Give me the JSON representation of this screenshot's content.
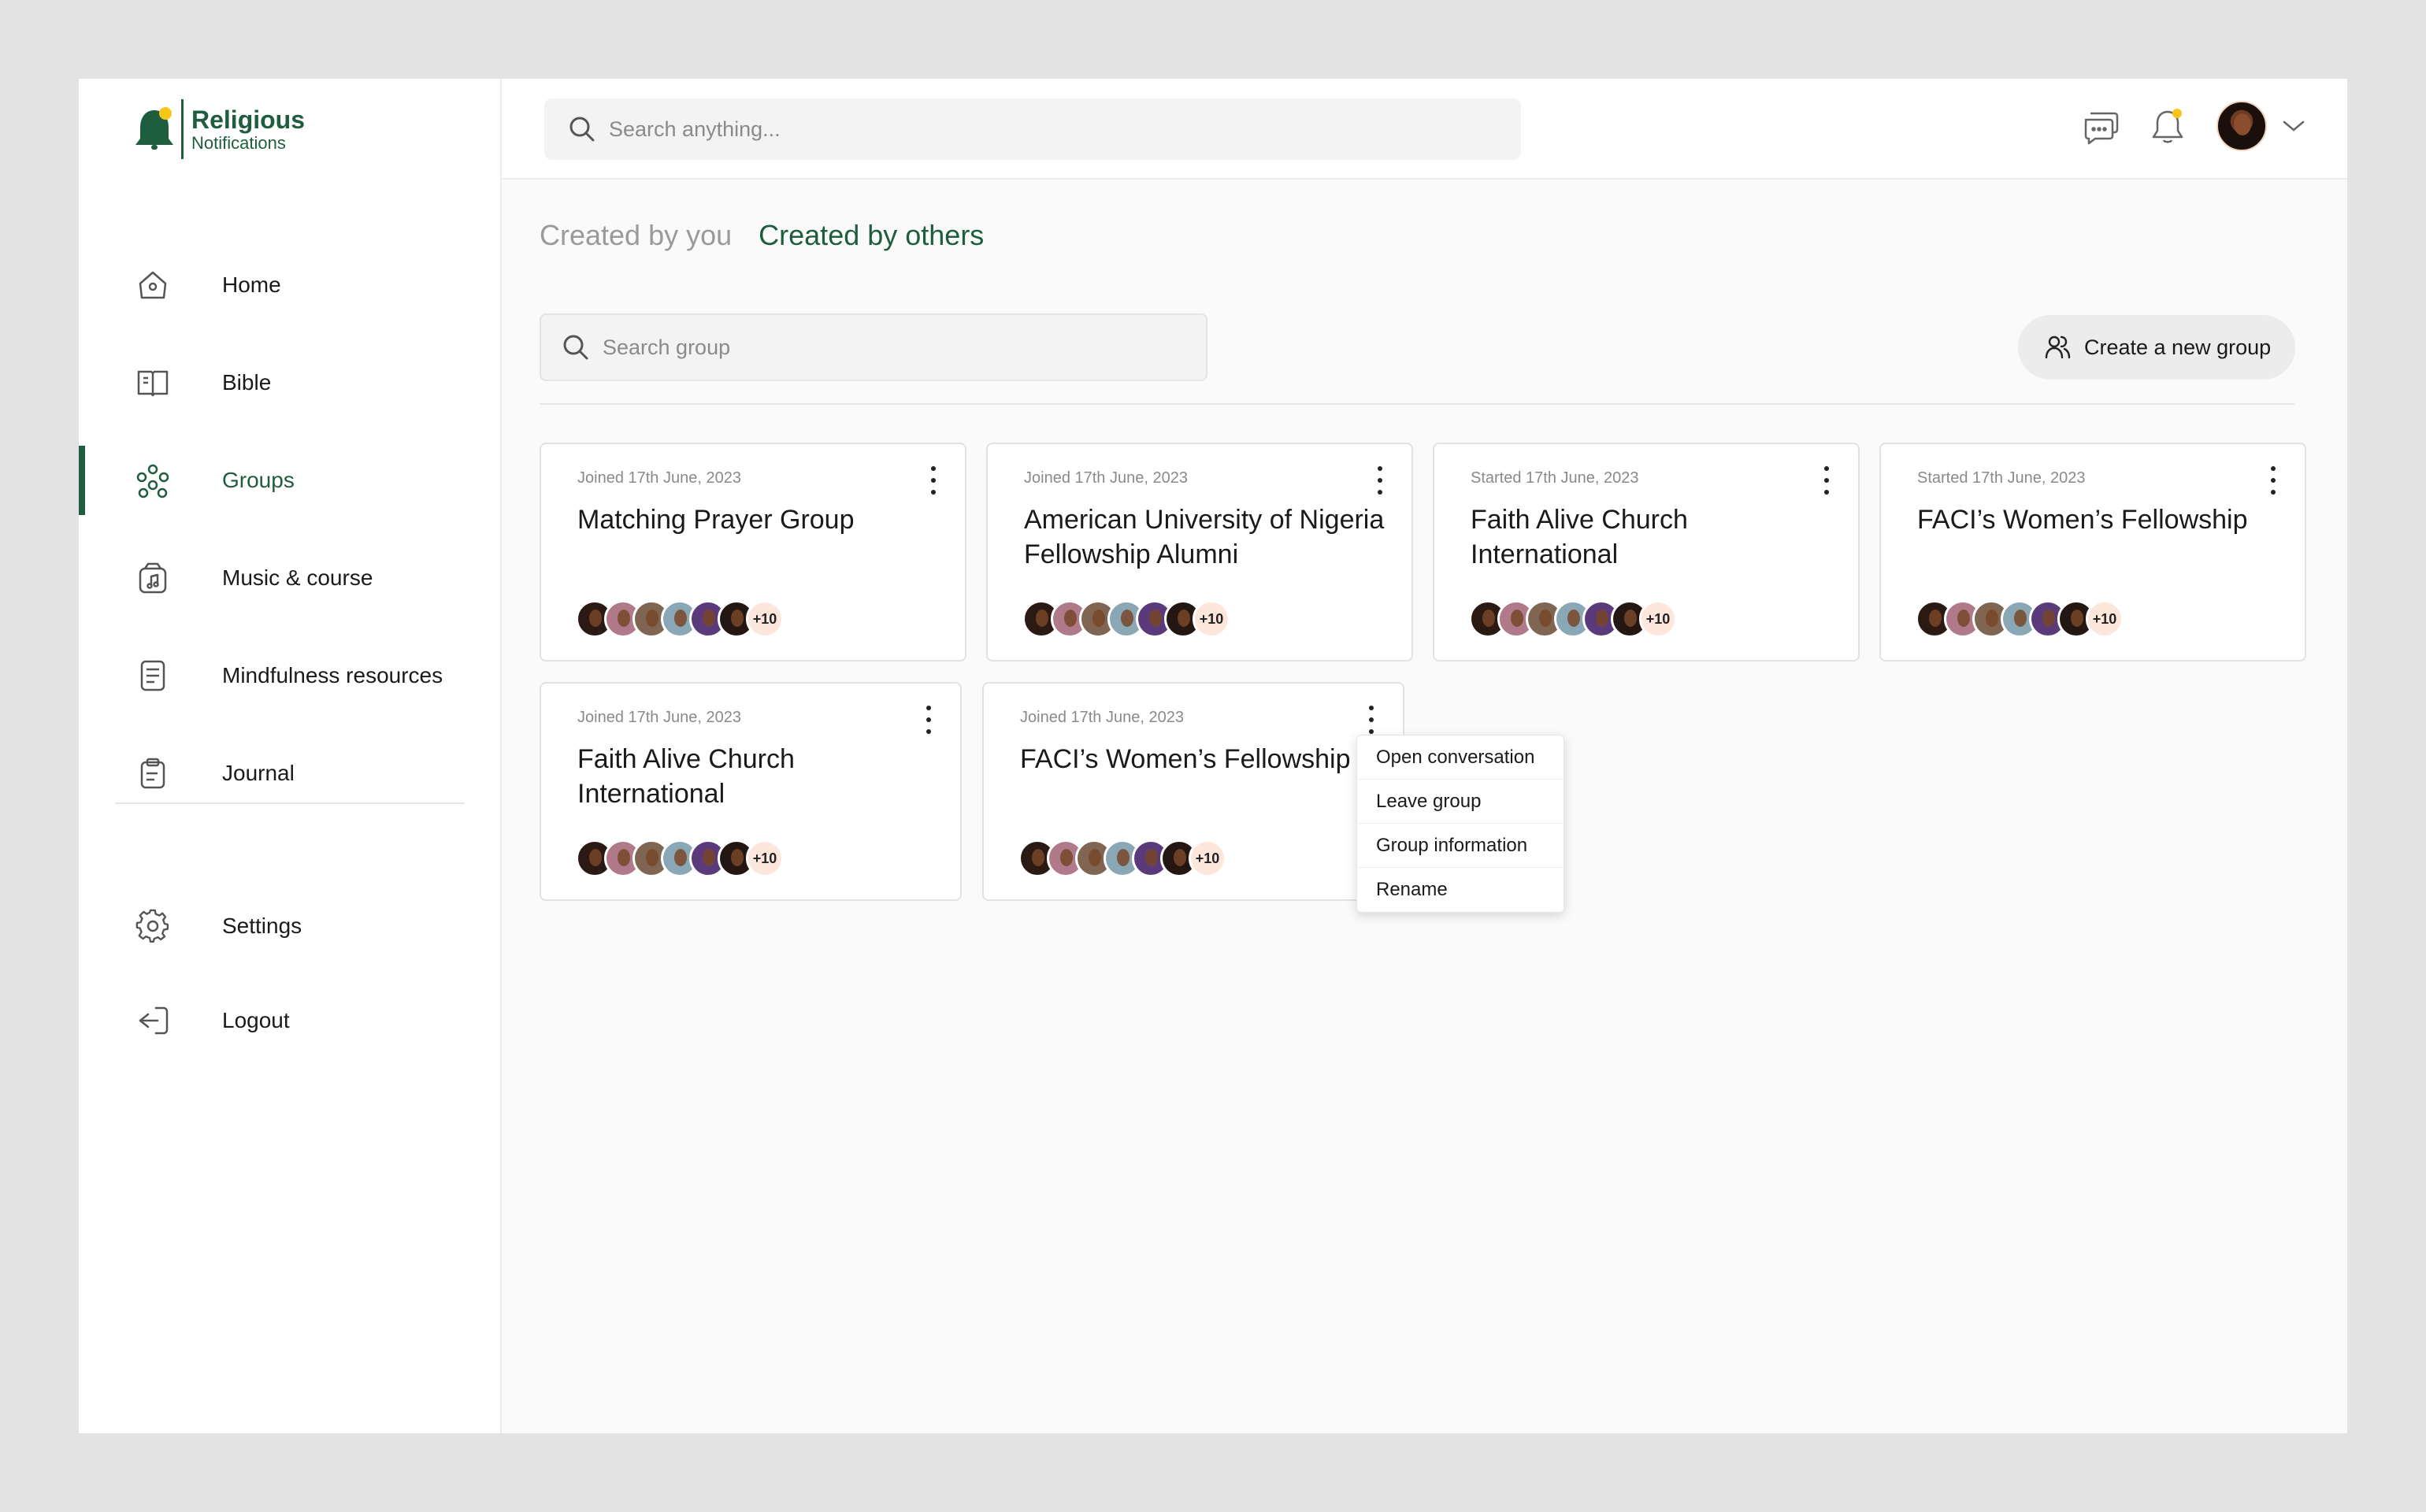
{
  "app": {
    "brand_line1": "Religious",
    "brand_line2": "Notifications",
    "brand_color": "#1f5d3f",
    "accent_color": "#f5c518"
  },
  "sidebar": {
    "items": [
      {
        "label": "Home",
        "icon": "home-icon"
      },
      {
        "label": "Bible",
        "icon": "book-icon"
      },
      {
        "label": "Groups",
        "icon": "groups-icon",
        "active": true
      },
      {
        "label": "Music & course",
        "icon": "music-icon"
      },
      {
        "label": "Mindfulness resources",
        "icon": "document-icon"
      },
      {
        "label": "Journal",
        "icon": "clipboard-icon"
      }
    ],
    "bottom_items": [
      {
        "label": "Settings",
        "icon": "gear-icon"
      },
      {
        "label": "Logout",
        "icon": "logout-icon"
      }
    ]
  },
  "header": {
    "search_placeholder": "Search anything..."
  },
  "main": {
    "tabs": [
      {
        "label": "Created by you",
        "active": false
      },
      {
        "label": "Created by others",
        "active": true
      }
    ],
    "group_search_placeholder": "Search group",
    "create_button_label": "Create a new group",
    "cards": [
      {
        "date": "Joined 17th June, 2023",
        "title": "Matching Prayer Group",
        "more_count": "+10"
      },
      {
        "date": "Joined 17th June, 2023",
        "title": "American University of Nigeria Fellowship Alumni",
        "more_count": "+10"
      },
      {
        "date": "Started 17th June, 2023",
        "title": "Faith Alive Church International",
        "more_count": "+10"
      },
      {
        "date": "Started 17th June, 2023",
        "title": "FACI’s Women’s Fellowship",
        "more_count": "+10"
      },
      {
        "date": "Joined 17th June, 2023",
        "title": "Faith Alive Church International",
        "more_count": "+10"
      },
      {
        "date": "Joined 17th June, 2023",
        "title": "FACI’s Women’s Fellowship",
        "more_count": "+10"
      }
    ],
    "context_menu": [
      "Open conversation",
      "Leave group",
      "Group information",
      "Rename"
    ]
  }
}
